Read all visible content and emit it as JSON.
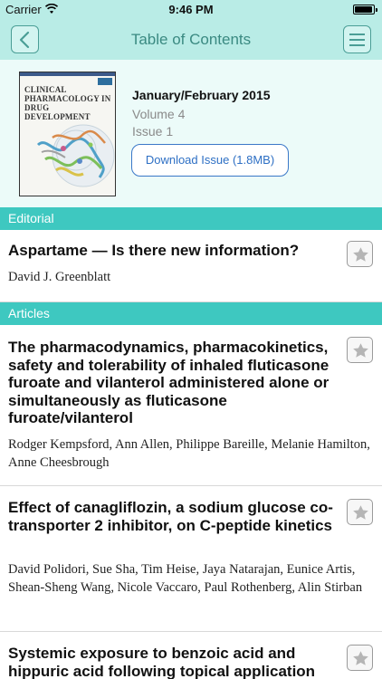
{
  "status_bar": {
    "carrier": "Carrier",
    "time": "9:46 PM"
  },
  "nav": {
    "title": "Table of Contents",
    "back_icon": "chevron-left-icon",
    "menu_icon": "hamburger-menu-icon"
  },
  "issue": {
    "cover_title": "CLINICAL PHARMACOLOGY IN DRUG DEVELOPMENT",
    "date": "January/February 2015",
    "volume": "Volume 4",
    "issue": "Issue 1",
    "download_label": "Download Issue (1.8MB)"
  },
  "sections": [
    {
      "name": "Editorial",
      "articles": [
        {
          "title": "Aspartame — Is there new information?",
          "authors": "David J. Greenblatt"
        }
      ]
    },
    {
      "name": "Articles",
      "articles": [
        {
          "title": "The pharmacodynamics, pharmacokinetics, safety and tolerability of inhaled fluticasone furoate and vilanterol administered alone or simultaneously as fluticasone furoate/vilanterol",
          "authors": "Rodger Kempsford, Ann Allen, Philippe Bareille, Melanie Hamilton, Anne Cheesbrough"
        },
        {
          "title": "Effect of canagliflozin, a sodium glucose co-transporter 2 inhibitor, on C-peptide kinetics",
          "authors": "David Polidori, Sue Sha, Tim Heise, Jaya Natarajan, Eunice Artis, Shean-Sheng Wang, Nicole Vaccaro, Paul Rothenberg, Alin Stirban"
        },
        {
          "title": "Systemic exposure to benzoic acid and hippuric acid following topical application",
          "authors": ""
        }
      ]
    }
  ],
  "colors": {
    "nav_bg": "#b9ece6",
    "section_bg": "#3ec8c0",
    "accent_blue": "#2d6fc4"
  }
}
